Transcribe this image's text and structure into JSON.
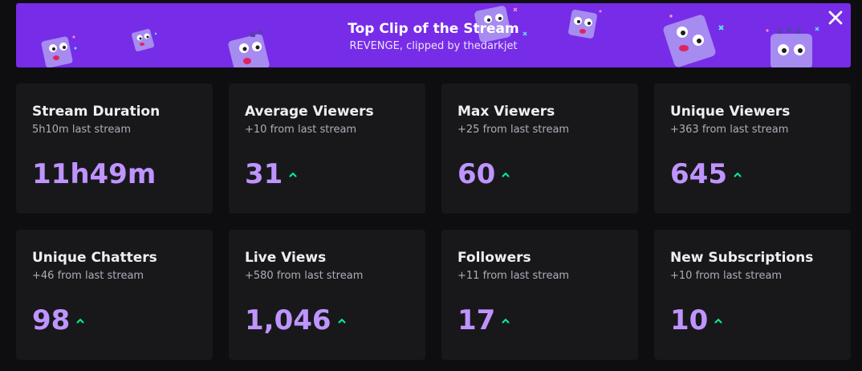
{
  "banner": {
    "title": "Top Clip of the Stream",
    "subtitle": "REVENGE, clipped by thedarkjet",
    "close_icon": "close-icon",
    "background": "#772ce8"
  },
  "colors": {
    "value": "#bf94ff",
    "up": "#00f593",
    "card_bg": "#18181b"
  },
  "stats": [
    {
      "title": "Stream Duration",
      "sub": "5h10m last stream",
      "value": "11h49m",
      "trend": "none"
    },
    {
      "title": "Average Viewers",
      "sub": "+10 from last stream",
      "value": "31",
      "trend": "up"
    },
    {
      "title": "Max Viewers",
      "sub": "+25 from last stream",
      "value": "60",
      "trend": "up"
    },
    {
      "title": "Unique Viewers",
      "sub": "+363 from last stream",
      "value": "645",
      "trend": "up"
    },
    {
      "title": "Unique Chatters",
      "sub": "+46 from last stream",
      "value": "98",
      "trend": "up"
    },
    {
      "title": "Live Views",
      "sub": "+580 from last stream",
      "value": "1,046",
      "trend": "up"
    },
    {
      "title": "Followers",
      "sub": "+11 from last stream",
      "value": "17",
      "trend": "up"
    },
    {
      "title": "New Subscriptions",
      "sub": "+10 from last stream",
      "value": "10",
      "trend": "up"
    }
  ]
}
